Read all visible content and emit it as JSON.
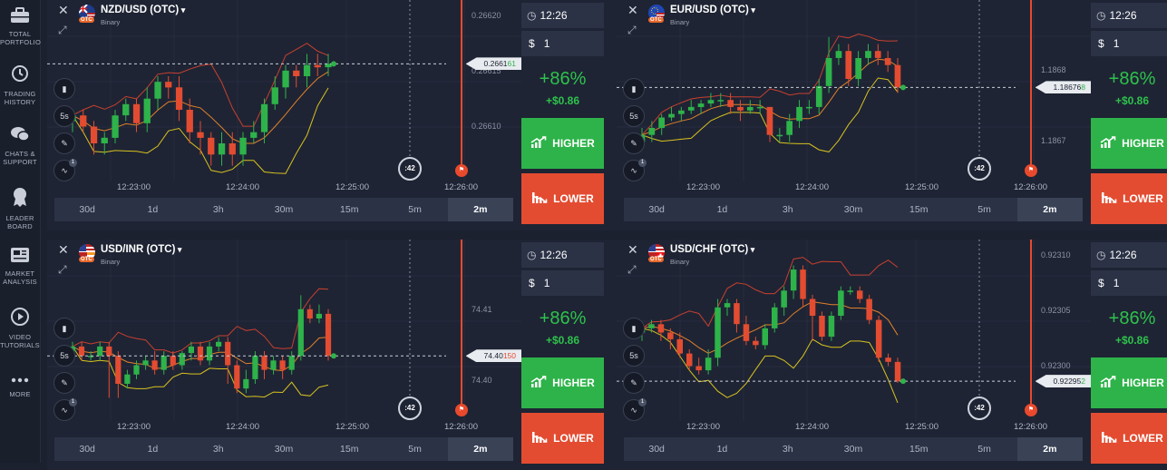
{
  "sidebar": [
    {
      "name": "total-portfolio",
      "label": "TOTAL PORTFOLIO",
      "icon": "briefcase-icon"
    },
    {
      "name": "trading-history",
      "label": "TRADING HISTORY",
      "icon": "history-icon"
    },
    {
      "name": "chats-support",
      "label": "CHATS & SUPPORT",
      "icon": "chat-icon"
    },
    {
      "name": "leader-board",
      "label": "LEADER BOARD",
      "icon": "medal-icon"
    },
    {
      "name": "market-analysis",
      "label": "MARKET ANALYSIS",
      "icon": "newspaper-icon"
    },
    {
      "name": "video-tutorials",
      "label": "VIDEO TUTORIALS",
      "icon": "play-icon"
    },
    {
      "name": "more",
      "label": "MORE",
      "icon": "dots-icon"
    }
  ],
  "timeframes": [
    "30d",
    "1d",
    "3h",
    "30m",
    "15m",
    "5m",
    "2m"
  ],
  "active_timeframe": "2m",
  "colors": {
    "up": "#2eb34a",
    "down": "#e34c31",
    "bg": "#1e2434",
    "accent": "#2ec24b"
  },
  "panels": [
    {
      "asset": "NZD/USD (OTC)",
      "type": "Binary",
      "flag": "nz-us",
      "price": "0.266161",
      "price_main": "0.2661",
      "price_tail": "61",
      "y_labels": [
        "0.26620",
        "0.26615",
        "0.26610"
      ],
      "x_labels": [
        "12:23:00",
        "12:24:00",
        "12:25:00",
        "12:26:00"
      ],
      "timer": ":42",
      "expiry": "12:26",
      "amount": "$",
      "amount_value": "1",
      "payout": "+86%",
      "profit": "+$0.86",
      "higher": "HIGHER",
      "lower": "LOWER",
      "tool_5s": "5s",
      "tool_badge": "1",
      "chart_data": {
        "type": "candlestick",
        "y_range": [
          0.26606,
          0.26621
        ],
        "candles": [
          [
            0.26611,
            0.266115,
            0.26612,
            0.2661
          ],
          [
            0.266115,
            0.266105,
            0.26612,
            0.2661
          ],
          [
            0.266105,
            0.26609,
            0.26611,
            0.26608
          ],
          [
            0.26609,
            0.266095,
            0.2661,
            0.26608
          ],
          [
            0.266095,
            0.266115,
            0.26612,
            0.26609
          ],
          [
            0.266115,
            0.266125,
            0.26613,
            0.26611
          ],
          [
            0.266125,
            0.266108,
            0.26613,
            0.2661
          ],
          [
            0.266108,
            0.26613,
            0.26614,
            0.2661
          ],
          [
            0.26613,
            0.266145,
            0.26615,
            0.26612
          ],
          [
            0.266145,
            0.26614,
            0.26615,
            0.26613
          ],
          [
            0.26614,
            0.26612,
            0.26615,
            0.26611
          ],
          [
            0.26612,
            0.2661,
            0.26613,
            0.26609
          ],
          [
            0.2661,
            0.266095,
            0.26611,
            0.26608
          ],
          [
            0.266095,
            0.26608,
            0.2661,
            0.26607
          ],
          [
            0.26608,
            0.26609,
            0.2661,
            0.26607
          ],
          [
            0.26609,
            0.26608,
            0.2661,
            0.26607
          ],
          [
            0.26608,
            0.266095,
            0.2661,
            0.26607
          ],
          [
            0.266095,
            0.2661,
            0.26611,
            0.26609
          ],
          [
            0.2661,
            0.266125,
            0.26613,
            0.26609
          ],
          [
            0.266125,
            0.26614,
            0.26615,
            0.26612
          ],
          [
            0.26614,
            0.266155,
            0.26616,
            0.26613
          ],
          [
            0.266155,
            0.26615,
            0.26616,
            0.26614
          ],
          [
            0.26615,
            0.26616,
            0.26617,
            0.26614
          ],
          [
            0.26616,
            0.266158,
            0.26617,
            0.26615
          ],
          [
            0.266158,
            0.266161,
            0.26617,
            0.26615
          ]
        ]
      }
    },
    {
      "asset": "EUR/USD (OTC)",
      "type": "Binary",
      "flag": "eu-us",
      "price": "1.186768",
      "price_main": "1.18676",
      "price_tail": "8",
      "y_labels": [
        "1.1868",
        "1.1867"
      ],
      "x_labels": [
        "12:23:00",
        "12:24:00",
        "12:25:00",
        "12:26:00"
      ],
      "timer": ":42",
      "expiry": "12:26",
      "amount": "$",
      "amount_value": "1",
      "payout": "+86%",
      "profit": "+$0.86",
      "higher": "HIGHER",
      "lower": "LOWER",
      "tool_5s": "5s",
      "tool_badge": "1",
      "chart_data": {
        "type": "candlestick",
        "y_range": [
          1.18664,
          1.18688
        ],
        "candles": [
          [
            1.18669,
            1.1867,
            1.18671,
            1.18668
          ],
          [
            1.1867,
            1.18671,
            1.18672,
            1.18669
          ],
          [
            1.18671,
            1.186725,
            1.18673,
            1.1867
          ],
          [
            1.186725,
            1.18673,
            1.18674,
            1.18672
          ],
          [
            1.18673,
            1.186735,
            1.18674,
            1.18672
          ],
          [
            1.186735,
            1.18674,
            1.18675,
            1.18673
          ],
          [
            1.18674,
            1.186745,
            1.18675,
            1.18673
          ],
          [
            1.186745,
            1.18675,
            1.18676,
            1.18674
          ],
          [
            1.18675,
            1.18675,
            1.18676,
            1.18674
          ],
          [
            1.18675,
            1.18674,
            1.18676,
            1.18673
          ],
          [
            1.18674,
            1.186735,
            1.18675,
            1.18672
          ],
          [
            1.186735,
            1.18674,
            1.18675,
            1.18673
          ],
          [
            1.18674,
            1.18674,
            1.18675,
            1.18673
          ],
          [
            1.18674,
            1.1867,
            1.18674,
            1.18669
          ],
          [
            1.1867,
            1.1867,
            1.18671,
            1.18669
          ],
          [
            1.1867,
            1.18672,
            1.18673,
            1.18669
          ],
          [
            1.18672,
            1.18674,
            1.18675,
            1.18671
          ],
          [
            1.18674,
            1.18674,
            1.18675,
            1.18673
          ],
          [
            1.18674,
            1.18677,
            1.18678,
            1.18673
          ],
          [
            1.18677,
            1.18681,
            1.18684,
            1.18676
          ],
          [
            1.18681,
            1.18682,
            1.18683,
            1.1868
          ],
          [
            1.18682,
            1.18678,
            1.18683,
            1.18677
          ],
          [
            1.18678,
            1.18681,
            1.18682,
            1.18677
          ],
          [
            1.18681,
            1.18682,
            1.18683,
            1.1868
          ],
          [
            1.18682,
            1.18681,
            1.18683,
            1.1868
          ],
          [
            1.18681,
            1.1868,
            1.18682,
            1.18679
          ],
          [
            1.1868,
            1.186768,
            1.18681,
            1.18676
          ]
        ]
      }
    },
    {
      "asset": "USD/INR (OTC)",
      "type": "Binary",
      "flag": "us-in",
      "price": "74.40150",
      "price_main": "74.40",
      "price_tail": "150",
      "y_labels": [
        "74.41",
        "74.40"
      ],
      "x_labels": [
        "12:23:00",
        "12:24:00",
        "12:25:00",
        "12:26:00"
      ],
      "timer": ":42",
      "expiry": "12:26",
      "amount": "$",
      "amount_value": "1",
      "payout": "+86%",
      "profit": "+$0.86",
      "higher": "HIGHER",
      "lower": "LOWER",
      "tool_5s": "5s",
      "tool_badge": "1",
      "chart_data": {
        "type": "candlestick",
        "y_range": [
          74.395,
          74.413
        ],
        "candles": [
          [
            74.402,
            74.4025,
            74.403,
            74.4015
          ],
          [
            74.4025,
            74.4015,
            74.403,
            74.401
          ],
          [
            74.4015,
            74.4015,
            74.402,
            74.401
          ],
          [
            74.4015,
            74.4025,
            74.403,
            74.401
          ],
          [
            74.4025,
            74.4015,
            74.403,
            74.397
          ],
          [
            74.4015,
            74.3985,
            74.402,
            74.397
          ],
          [
            74.3985,
            74.3995,
            74.4,
            74.398
          ],
          [
            74.3995,
            74.4005,
            74.401,
            74.399
          ],
          [
            74.4005,
            74.401,
            74.4015,
            74.4
          ],
          [
            74.401,
            74.4,
            74.402,
            74.3995
          ],
          [
            74.4,
            74.4015,
            74.402,
            74.3995
          ],
          [
            74.4015,
            74.4005,
            74.402,
            74.4
          ],
          [
            74.4005,
            74.4018,
            74.402,
            74.4
          ],
          [
            74.4018,
            74.4025,
            74.403,
            74.401
          ],
          [
            74.4025,
            74.401,
            74.403,
            74.4005
          ],
          [
            74.401,
            74.4025,
            74.403,
            74.4005
          ],
          [
            74.4025,
            74.403,
            74.4035,
            74.402
          ],
          [
            74.403,
            74.4005,
            74.4035,
            74.3985
          ],
          [
            74.4005,
            74.398,
            74.401,
            74.3975
          ],
          [
            74.398,
            74.399,
            74.4,
            74.3975
          ],
          [
            74.399,
            74.4015,
            74.402,
            74.3985
          ],
          [
            74.4015,
            74.4,
            74.402,
            74.399
          ],
          [
            74.4,
            74.401,
            74.4015,
            74.3995
          ],
          [
            74.401,
            74.4,
            74.4015,
            74.399
          ],
          [
            74.4,
            74.4015,
            74.402,
            74.3995
          ],
          [
            74.4015,
            74.4065,
            74.408,
            74.401
          ],
          [
            74.4065,
            74.4055,
            74.407,
            74.405
          ],
          [
            74.4055,
            74.406,
            74.407,
            74.405
          ],
          [
            74.406,
            74.4015,
            74.4065,
            74.401
          ]
        ]
      }
    },
    {
      "asset": "USD/CHF (OTC)",
      "type": "Binary",
      "flag": "us-ch",
      "price": "0.922952",
      "price_main": "0.92295",
      "price_tail": "2",
      "y_labels": [
        "0.92310",
        "0.92305",
        "0.92300"
      ],
      "x_labels": [
        "12:23:00",
        "12:24:00",
        "12:25:00",
        "12:26:00"
      ],
      "timer": ":42",
      "expiry": "12:26",
      "amount": "$",
      "amount_value": "1",
      "payout": "+86%",
      "profit": "+$0.86",
      "higher": "HIGHER",
      "lower": "LOWER",
      "tool_5s": "5s",
      "tool_badge": "1",
      "chart_data": {
        "type": "candlestick",
        "y_range": [
          0.92291,
          0.92311
        ],
        "candles": [
          [
            0.92301,
            0.923015,
            0.92302,
            0.923
          ],
          [
            0.923015,
            0.92302,
            0.923025,
            0.92301
          ],
          [
            0.92302,
            0.92301,
            0.923025,
            0.923
          ],
          [
            0.92301,
            0.923002,
            0.923015,
            0.92299
          ],
          [
            0.923002,
            0.922985,
            0.92301,
            0.92298
          ],
          [
            0.922985,
            0.92297,
            0.92299,
            0.922965
          ],
          [
            0.92297,
            0.922965,
            0.92298,
            0.92296
          ],
          [
            0.922965,
            0.92298,
            0.92299,
            0.92296
          ],
          [
            0.92298,
            0.92304,
            0.92305,
            0.92297
          ],
          [
            0.92304,
            0.923045,
            0.92305,
            0.92303
          ],
          [
            0.923045,
            0.92302,
            0.92305,
            0.92301
          ],
          [
            0.92302,
            0.923,
            0.92303,
            0.922995
          ],
          [
            0.923,
            0.922995,
            0.923005,
            0.92299
          ],
          [
            0.922995,
            0.923015,
            0.92302,
            0.92299
          ],
          [
            0.923015,
            0.92304,
            0.923045,
            0.92301
          ],
          [
            0.92304,
            0.92306,
            0.923065,
            0.92303
          ],
          [
            0.92306,
            0.923085,
            0.92309,
            0.92305
          ],
          [
            0.923085,
            0.92305,
            0.92309,
            0.92304
          ],
          [
            0.92305,
            0.92303,
            0.923055,
            0.923
          ],
          [
            0.92303,
            0.923005,
            0.923035,
            0.923
          ],
          [
            0.923005,
            0.92303,
            0.923035,
            0.923
          ],
          [
            0.92303,
            0.92306,
            0.923065,
            0.923025
          ],
          [
            0.92306,
            0.92306,
            0.923065,
            0.923055
          ],
          [
            0.92306,
            0.92305,
            0.923065,
            0.923045
          ],
          [
            0.92305,
            0.923025,
            0.923055,
            0.92302
          ],
          [
            0.923025,
            0.92298,
            0.92303,
            0.922975
          ],
          [
            0.92298,
            0.922975,
            0.922985,
            0.92297
          ],
          [
            0.922975,
            0.922952,
            0.92298,
            0.92295
          ]
        ]
      }
    }
  ]
}
